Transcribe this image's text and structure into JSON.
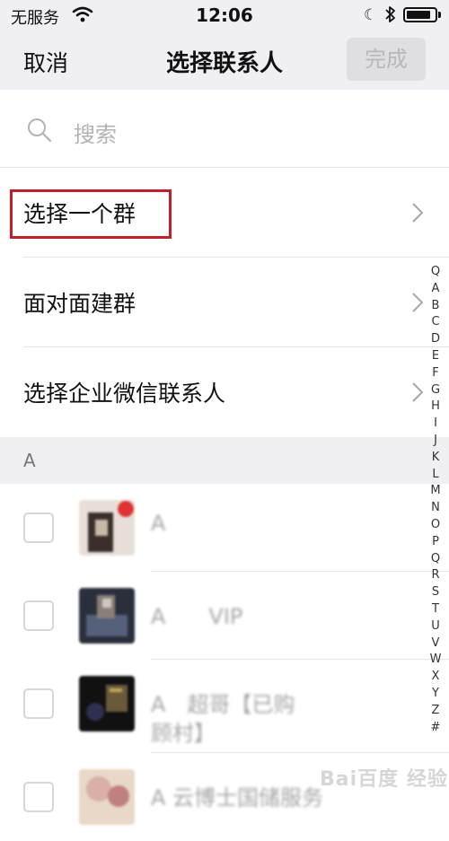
{
  "status": {
    "carrier": "无服务",
    "time": "12:06",
    "battery_level": 0.88
  },
  "nav": {
    "cancel": "取消",
    "title": "选择联系人",
    "done": "完成"
  },
  "search": {
    "placeholder": "搜索"
  },
  "actions": [
    {
      "label": "选择一个群"
    },
    {
      "label": "面对面建群"
    },
    {
      "label": "选择企业微信联系人"
    }
  ],
  "section": {
    "letter": "A"
  },
  "contacts": [
    {
      "name": "A",
      "name2": "",
      "avatar_colors": [
        "#e8e0d8",
        "#3a2f2a",
        "#c33"
      ]
    },
    {
      "name": "A　　VIP",
      "name2": "",
      "avatar_colors": [
        "#2b2f3c",
        "#55607a",
        "#d0c8c0"
      ]
    },
    {
      "name": "A　超哥【已购",
      "name2": "顾村】",
      "avatar_colors": [
        "#111111",
        "#6a5a3a",
        "#2f2f4f"
      ]
    },
    {
      "name": "A 云博士国储服务",
      "name2": "",
      "avatar_colors": [
        "#d8b0a8",
        "#c08080",
        "#e8d8c8"
      ]
    }
  ],
  "index_letters": [
    "Q",
    "A",
    "B",
    "C",
    "D",
    "E",
    "F",
    "G",
    "H",
    "I",
    "J",
    "K",
    "L",
    "M",
    "N",
    "O",
    "P",
    "Q",
    "R",
    "S",
    "T",
    "U",
    "V",
    "W",
    "X",
    "Y",
    "Z",
    "#"
  ],
  "watermark": "Bai百度 经验",
  "colors": {
    "highlight": "#c41e2a",
    "nav_bg": "#efeff4"
  }
}
